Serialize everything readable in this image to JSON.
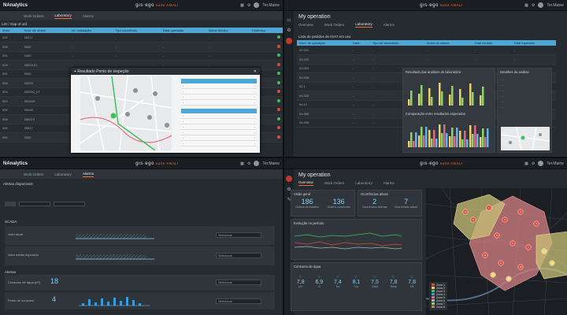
{
  "app": {
    "title": "NAnalytics",
    "brand": "gıs·ego",
    "brand_sub": "suite ANALI",
    "user": "Ter.Maine"
  },
  "q1": {
    "tabs": [
      "Work Orders",
      "Laboratory",
      "Alarms"
    ],
    "active_tab": 1,
    "section": "List / Gap of ord",
    "columns": [
      "Work",
      "Num. de ordem",
      "Nr. Instalação",
      "Tipo ocorrência",
      "Data operação",
      "Nome técnico",
      "Endereço"
    ],
    "rows": [
      [
        "000",
        "30017",
        "-",
        "-",
        "-",
        "-",
        ""
      ],
      [
        "006",
        "3030",
        "-",
        "-",
        "-",
        "-",
        ""
      ],
      [
        "001",
        "3180",
        "-",
        "-",
        "-",
        "-",
        ""
      ],
      [
        "008",
        "30024-01",
        "-",
        "-",
        "-",
        "-",
        ""
      ],
      [
        "001",
        "3000",
        "-",
        "-",
        "-",
        "-",
        ""
      ],
      [
        "006",
        "30025",
        "-",
        "-",
        "-",
        "-",
        ""
      ],
      [
        "004",
        "300252_07",
        "-",
        "-",
        "-",
        "-",
        ""
      ],
      [
        "002",
        "301000",
        "-",
        "-",
        "-",
        "-",
        ""
      ],
      [
        "000",
        "30008",
        "-",
        "-",
        "-",
        "-",
        ""
      ],
      [
        "008",
        "300010",
        "-",
        "-",
        "-",
        "-",
        ""
      ],
      [
        "000",
        "30017",
        "-",
        "-",
        "-",
        "-",
        ""
      ],
      [
        "000",
        "3330",
        "-",
        "-",
        "-",
        "-",
        ""
      ]
    ],
    "popup_title": "Resultado Ponto de inspeção",
    "status_colors": [
      "#3fbf5f",
      "#e04a3a",
      "#3fbf5f",
      "#e04a3a",
      "#3fbf5f",
      "#3fbf5f",
      "#e04a3a",
      "#3fbf5f",
      "#e04a3a",
      "#3fbf5f",
      "#e04a3a",
      "#e04a3a"
    ]
  },
  "q2": {
    "header": "My operation",
    "tabs": [
      "Overview",
      "Work Orders",
      "Laboratory",
      "Alarms"
    ],
    "active_tab": 2,
    "section": "Lista de pedidos de IGAT em uso",
    "columns": [
      "Num. de operação",
      "Data",
      "Tipo de laboratório",
      "Nome do cliente",
      "Total medido",
      "Total esperado"
    ],
    "rows": [
      [
        "02.001",
        "-",
        "-",
        "-",
        "-",
        "-"
      ],
      [
        "02.002",
        "-",
        "-",
        "-",
        "-",
        "-"
      ],
      [
        "03.004",
        "-",
        "-",
        "-",
        "-",
        "-"
      ],
      [
        "04.008",
        "-",
        "-",
        "-",
        "-",
        "-"
      ],
      [
        "02.1",
        "-",
        "-",
        "-",
        "-",
        "-"
      ],
      [
        "04.008",
        "-",
        "-",
        "-",
        "-",
        "-"
      ],
      [
        "04.10",
        "-",
        "-",
        "-",
        "-",
        "-"
      ],
      [
        "04.008",
        "-",
        "-",
        "-",
        "-",
        "-"
      ],
      [
        "04.008",
        "-",
        "-",
        "-",
        "-",
        "-"
      ]
    ],
    "chart1_title": "Resultado das análises de laboratório",
    "chart2_title": "Comparação entre resultados esperados",
    "side_title": "Detalhes da análise"
  },
  "q3": {
    "tabs": [
      "Work Orders",
      "Laboratory",
      "Alarms"
    ],
    "active_tab": 2,
    "section": "Alertas disponíveis",
    "sub1": "SCADA",
    "sub2": "Alertas",
    "row_labels": [
      "Valor atual",
      "Valor médio esperado",
      "Consumo de água (m³)",
      "Ponto de consumo"
    ],
    "kpi1": "18",
    "kpi2": "4",
    "select_label": "Selecionar"
  },
  "q4": {
    "header": "My operation",
    "tabs": [
      "Overview",
      "Work Orders",
      "Laboratory",
      "Alarms"
    ],
    "active_tab": 0,
    "card1_title": "Visão geral",
    "card1_vals": [
      "186",
      "136"
    ],
    "card1_labels": [
      "Ordens de trabalho",
      "Ordens concluídas"
    ],
    "card2_title": "Ocorrências ativas",
    "card2_vals": [
      "2",
      "7"
    ],
    "card2_labels": [
      "Ocorrências abertas",
      "Ocorrências ativas"
    ],
    "card3_title": "Evolução no período",
    "card4_title": "Consumo de água",
    "small_kpis": [
      "7,8",
      "6,9",
      "7,4",
      "8,1",
      "7,5",
      "7,8",
      "7,8"
    ],
    "small_kpi_labels": [
      "pH",
      "Cl",
      "Tur",
      "Cor",
      "Cond",
      "Temp",
      "O2"
    ],
    "legend": [
      "Zona 1",
      "Zona 2",
      "Zona 3",
      "Zona 4",
      "Zona 5",
      "Zona 6",
      "Zona 7",
      "Zona 8"
    ],
    "map_markers": [
      "1",
      "2",
      "3",
      "4",
      "5",
      "6",
      "7",
      "8",
      "9",
      "10",
      "11",
      "12",
      "13",
      "14",
      "15",
      "16"
    ]
  }
}
